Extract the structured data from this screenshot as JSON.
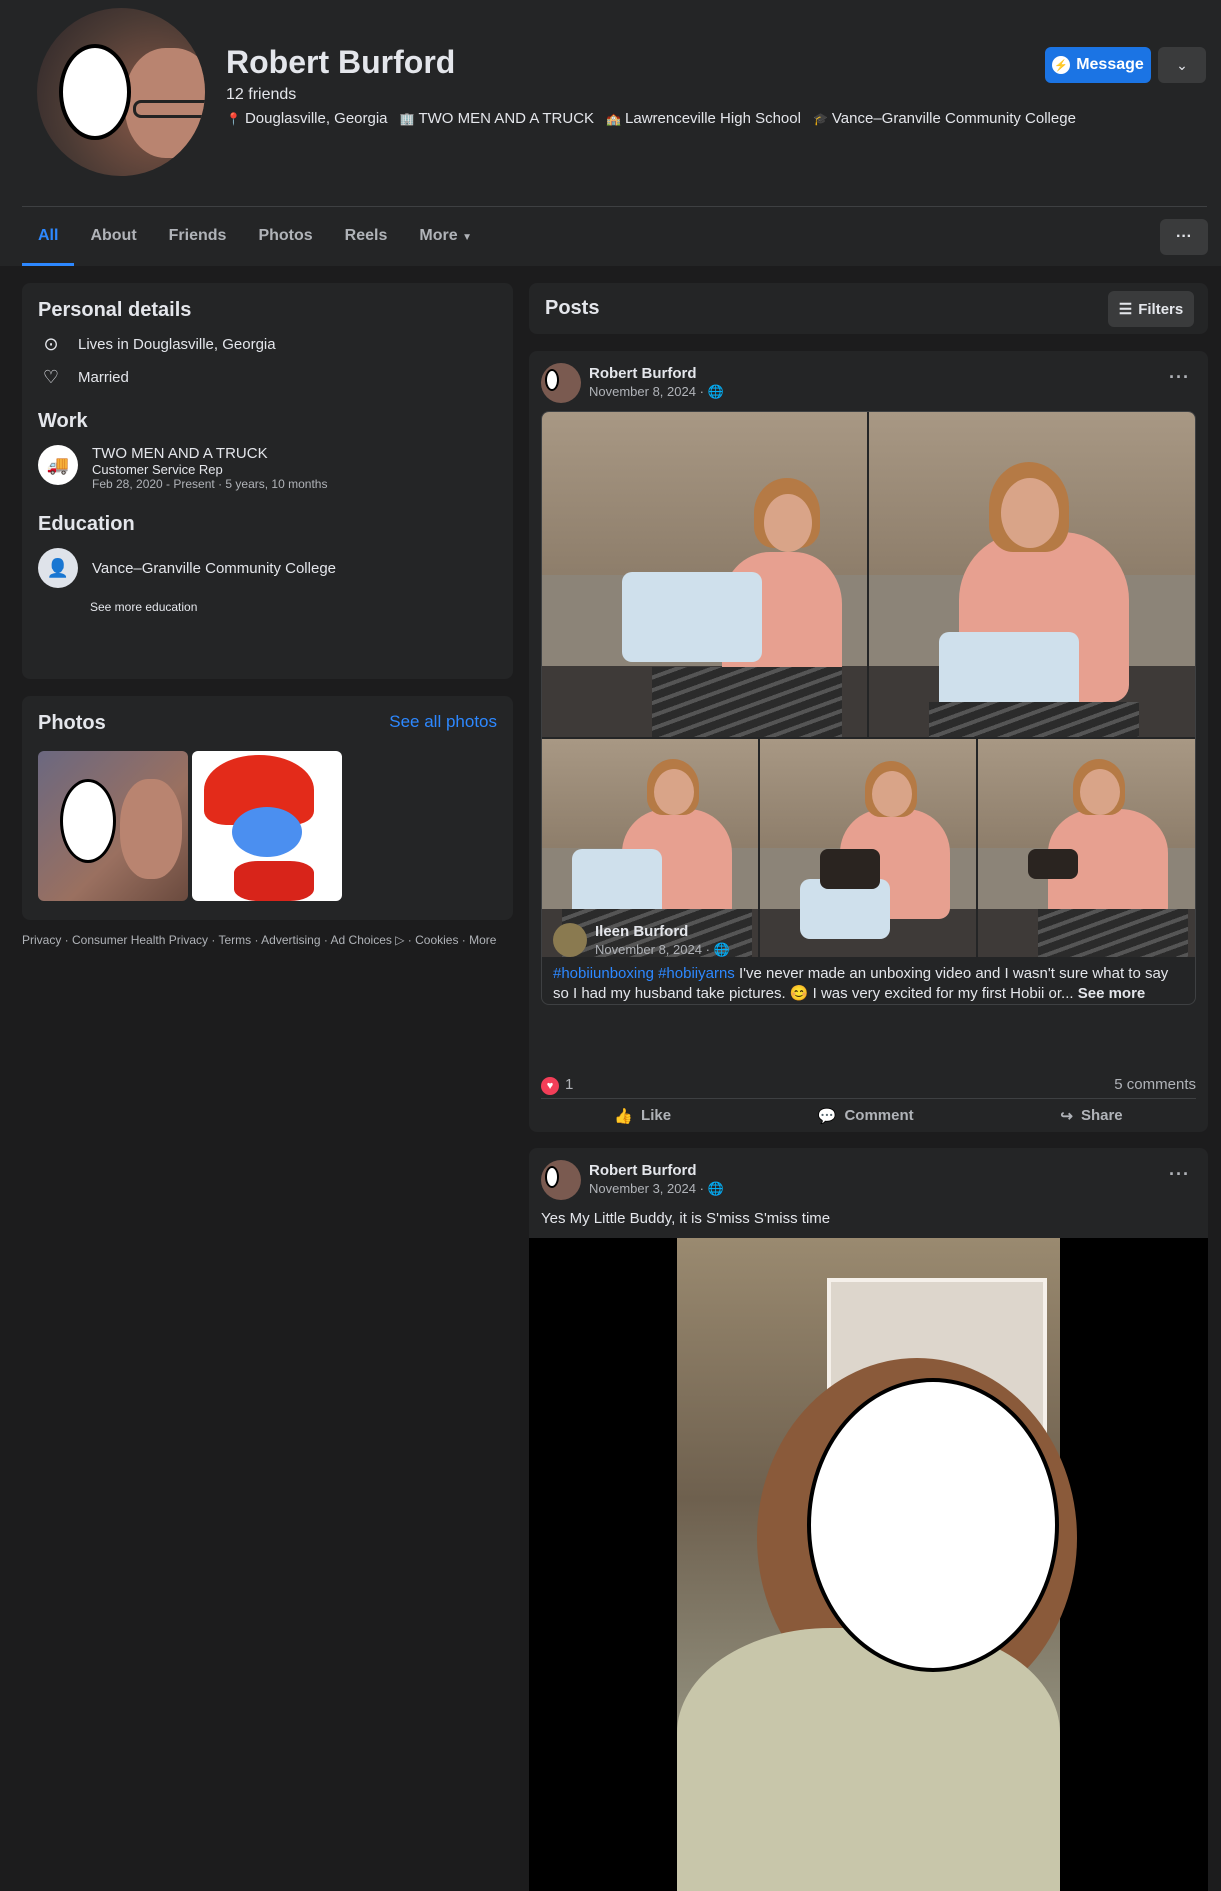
{
  "profile": {
    "name": "Robert Burford",
    "friends": "12 friends",
    "meta": [
      {
        "icon": "location-pin-icon",
        "text": "Douglasville, Georgia"
      },
      {
        "icon": "work-icon",
        "text": "TWO MEN AND A TRUCK"
      },
      {
        "icon": "school-icon",
        "text": "Lawrenceville High School"
      },
      {
        "icon": "graduation-cap-icon",
        "text": "Vance–Granville Community College"
      }
    ],
    "message_label": "Message"
  },
  "tabs": [
    "All",
    "About",
    "Friends",
    "Photos",
    "Reels",
    "More"
  ],
  "personal_details": {
    "title": "Personal details",
    "lives": "Lives in Douglasville, Georgia",
    "relationship": "Married"
  },
  "work": {
    "title": "Work",
    "company": "TWO MEN AND A TRUCK",
    "role": "Customer Service Rep",
    "dates": "Feb 28, 2020 - Present · 5 years, 10 months"
  },
  "education": {
    "title": "Education",
    "school": "Vance–Granville Community College",
    "see_more": "See more education"
  },
  "photos": {
    "title": "Photos",
    "see_all": "See all photos"
  },
  "footer": {
    "links": "Privacy · Consumer Health Privacy · Terms · Advertising · Ad Choices ▷ · Cookies · More"
  },
  "posts": {
    "title": "Posts",
    "filters_label": "Filters",
    "post1": {
      "author": "Robert Burford",
      "date": "November 8, 2024 · 🌐",
      "shared_author": "Ileen Burford",
      "shared_date": "November 8, 2024 · 🌐",
      "hashtag1": "#hobiiunboxing",
      "hashtag2": "#hobiiyarns",
      "text": "I've never made an unboxing video and I wasn't sure what to say so I had my husband take pictures. 😊 I was very excited for my first Hobii or...",
      "see_more": "See more",
      "reactions": "1",
      "comments": "5 comments",
      "like": "Like",
      "comment": "Comment",
      "share": "Share"
    },
    "post2": {
      "author": "Robert Burford",
      "date": "November 3, 2024 · 🌐",
      "text": "Yes My Little Buddy, it is S'miss S'miss time"
    }
  },
  "colors": {
    "accent": "#2d88ff",
    "bg": "#1c1c1d",
    "card": "#242526"
  }
}
